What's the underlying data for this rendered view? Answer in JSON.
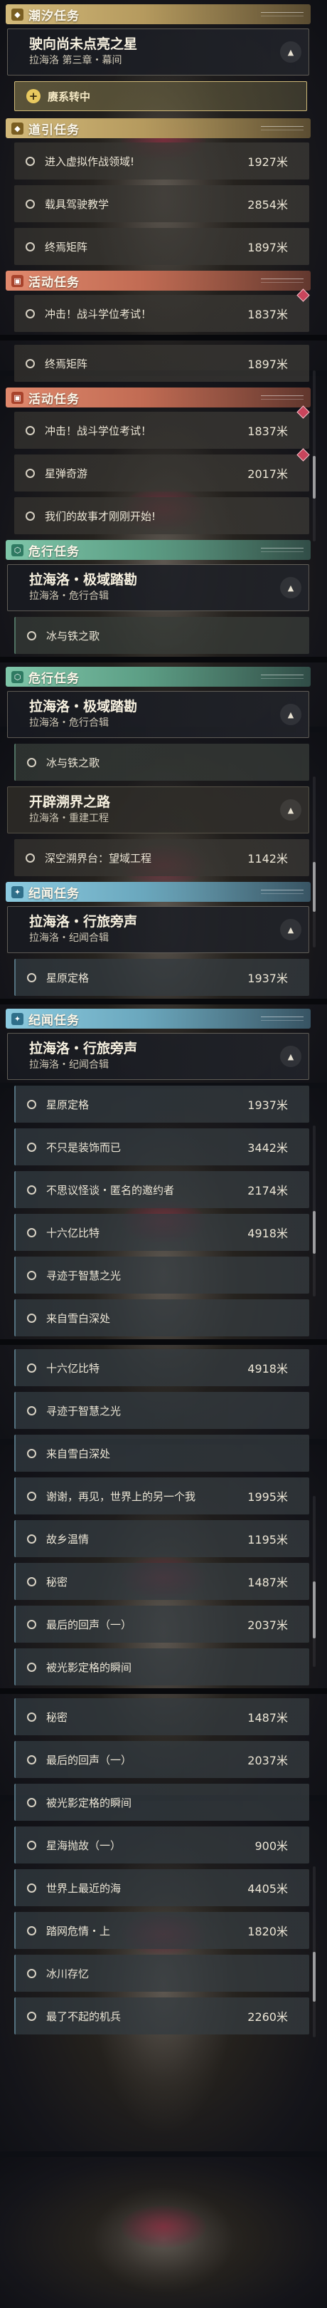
{
  "sections": [
    {
      "header": {
        "title": "潮汐任务",
        "theme": "gold"
      }
    },
    {
      "card": {
        "title": "驶向尚未点亮之星",
        "subtitle": "拉海洛 第三章・幕间"
      }
    },
    {
      "button": {
        "label": "赓系转中"
      }
    },
    {
      "header": {
        "title": "道引任务",
        "theme": "gold"
      }
    },
    {
      "row": {
        "name": "进入虚拟作战领域!",
        "dist": "1927米"
      }
    },
    {
      "row": {
        "name": "载具驾驶教学",
        "dist": "2854米"
      }
    },
    {
      "row": {
        "name": "终焉矩阵",
        "dist": "1897米"
      }
    },
    {
      "header": {
        "title": "活动任务",
        "theme": "orange"
      }
    },
    {
      "row": {
        "name": "冲击！战斗学位考试！",
        "dist": "1837米",
        "flag": true
      }
    },
    {
      "sep": true
    },
    {
      "row": {
        "name": "终焉矩阵",
        "dist": "1897米"
      }
    },
    {
      "header": {
        "title": "活动任务",
        "theme": "orange"
      }
    },
    {
      "row": {
        "name": "冲击！战斗学位考试！",
        "dist": "1837米",
        "flag": true
      }
    },
    {
      "row": {
        "name": "星弹奇游",
        "dist": "2017米",
        "flag": true
      }
    },
    {
      "row": {
        "name": "我们的故事才刚刚开始!",
        "dist": ""
      }
    },
    {
      "header": {
        "title": "危行任务",
        "theme": "green"
      }
    },
    {
      "card": {
        "title": "拉海洛・极域踏勘",
        "subtitle": "拉海洛・危行合辑"
      }
    },
    {
      "row": {
        "name": "冰与铁之歌",
        "dist": "",
        "tone": "green"
      }
    },
    {
      "sep": true
    },
    {
      "header": {
        "title": "危行任务",
        "theme": "green"
      }
    },
    {
      "card": {
        "title": "拉海洛・极域踏勘",
        "subtitle": "拉海洛・危行合辑"
      }
    },
    {
      "row": {
        "name": "冰与铁之歌",
        "dist": "",
        "tone": "green"
      }
    },
    {
      "card": {
        "title": "开辟溯界之路",
        "subtitle": "拉海洛・重建工程",
        "plain": true
      }
    },
    {
      "row": {
        "name": "深空溯界台：望域工程",
        "dist": "1142米"
      }
    },
    {
      "header": {
        "title": "纪闻任务",
        "theme": "blue"
      }
    },
    {
      "card": {
        "title": "拉海洛・行旅旁声",
        "subtitle": "拉海洛・纪闻合辑"
      }
    },
    {
      "row": {
        "name": "星原定格",
        "dist": "1937米",
        "tone": "blue"
      }
    },
    {
      "sep": true
    },
    {
      "header": {
        "title": "纪闻任务",
        "theme": "blue"
      }
    },
    {
      "card": {
        "title": "拉海洛・行旅旁声",
        "subtitle": "拉海洛・纪闻合辑"
      }
    },
    {
      "row": {
        "name": "星原定格",
        "dist": "1937米",
        "tone": "blue"
      }
    },
    {
      "row": {
        "name": "不只是装饰而已",
        "dist": "3442米",
        "tone": "blue"
      }
    },
    {
      "row": {
        "name": "不思议怪谈・匿名的邀约者",
        "dist": "2174米",
        "tone": "blue"
      }
    },
    {
      "row": {
        "name": "十六亿比特",
        "dist": "4918米",
        "tone": "blue"
      }
    },
    {
      "row": {
        "name": "寻迹于智慧之光",
        "dist": "",
        "tone": "blue"
      }
    },
    {
      "row": {
        "name": "来自雪白深处",
        "dist": "",
        "tone": "blue"
      }
    },
    {
      "sep": true
    },
    {
      "row": {
        "name": "十六亿比特",
        "dist": "4918米",
        "tone": "blue"
      }
    },
    {
      "row": {
        "name": "寻迹于智慧之光",
        "dist": "",
        "tone": "blue"
      }
    },
    {
      "row": {
        "name": "来自雪白深处",
        "dist": "",
        "tone": "blue"
      }
    },
    {
      "row": {
        "name": "谢谢，再见，世界上的另一个我",
        "dist": "1995米",
        "tone": "blue"
      }
    },
    {
      "row": {
        "name": "故乡温情",
        "dist": "1195米",
        "tone": "blue"
      }
    },
    {
      "row": {
        "name": "秘密",
        "dist": "1487米",
        "tone": "blue"
      }
    },
    {
      "row": {
        "name": "最后的回声（一）",
        "dist": "2037米",
        "tone": "blue"
      }
    },
    {
      "row": {
        "name": "被光影定格的瞬间",
        "dist": "",
        "tone": "blue"
      }
    },
    {
      "sep": true
    },
    {
      "row": {
        "name": "秘密",
        "dist": "1487米",
        "tone": "blue"
      }
    },
    {
      "row": {
        "name": "最后的回声（一）",
        "dist": "2037米",
        "tone": "blue"
      }
    },
    {
      "row": {
        "name": "被光影定格的瞬间",
        "dist": "",
        "tone": "blue"
      }
    },
    {
      "row": {
        "name": "星海抛故（一）",
        "dist": "900米",
        "tone": "blue"
      }
    },
    {
      "row": {
        "name": "世界上最近的海",
        "dist": "4405米",
        "tone": "blue"
      }
    },
    {
      "row": {
        "name": "踏网危情・上",
        "dist": "1820米",
        "tone": "blue"
      }
    },
    {
      "row": {
        "name": "冰川存忆",
        "dist": "",
        "tone": "blue"
      }
    },
    {
      "row": {
        "name": "最了不起的机兵",
        "dist": "2260米",
        "tone": "blue"
      }
    }
  ],
  "icons": {
    "gold": "map-pin-icon",
    "orange": "calendar-icon",
    "green": "shield-icon",
    "blue": "star-icon",
    "collapse": "chevron-up-icon",
    "marker": "circle-marker-icon",
    "flag": "red-diamond-flag-icon"
  },
  "colors": {
    "gold": "#d2b97a",
    "orange": "#e0896d",
    "green": "#7fc6a9",
    "blue": "#8ccbe0",
    "flag": "#c8455c"
  }
}
